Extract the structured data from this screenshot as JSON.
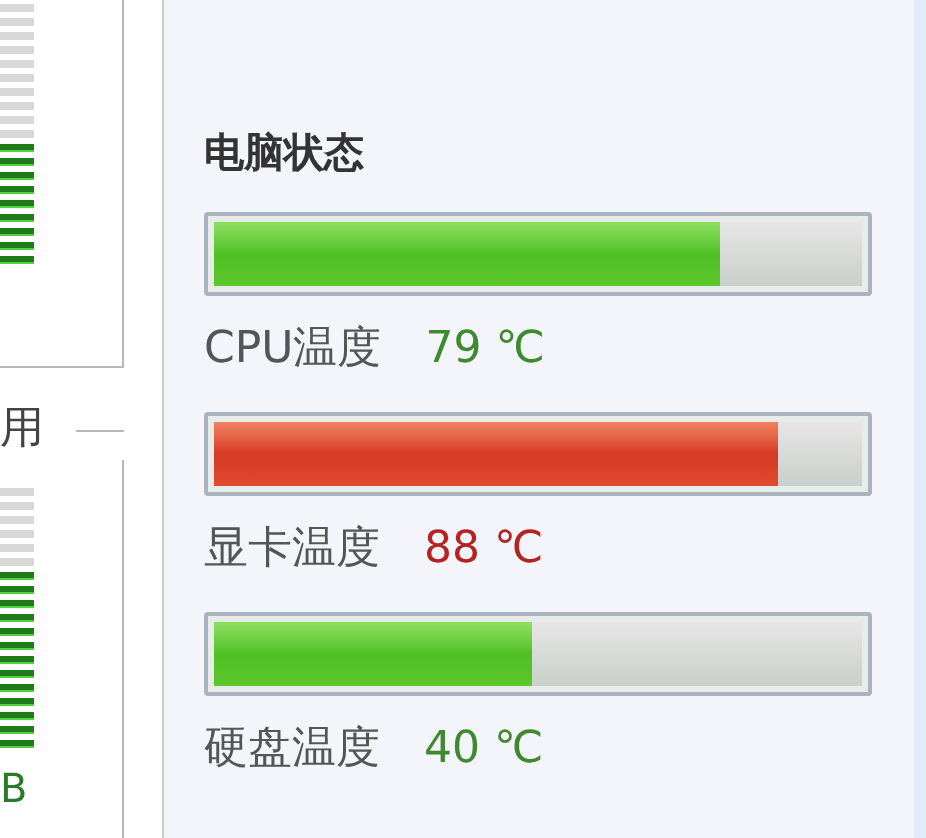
{
  "groups": [
    {
      "meter": {
        "level": 0.45
      }
    },
    {
      "title": "用",
      "meter": {
        "level": 0.68
      },
      "caption": "B"
    }
  ],
  "status": {
    "heading": "电脑状态",
    "sensors": [
      {
        "label": "CPU温度",
        "reading": "79 ℃",
        "level": 0.78,
        "kind": "normal"
      },
      {
        "label": "显卡温度",
        "reading": "88 ℃",
        "level": 0.87,
        "kind": "hot"
      },
      {
        "label": "硬盘温度",
        "reading": "40 ℃",
        "level": 0.49,
        "kind": "normal"
      }
    ]
  }
}
